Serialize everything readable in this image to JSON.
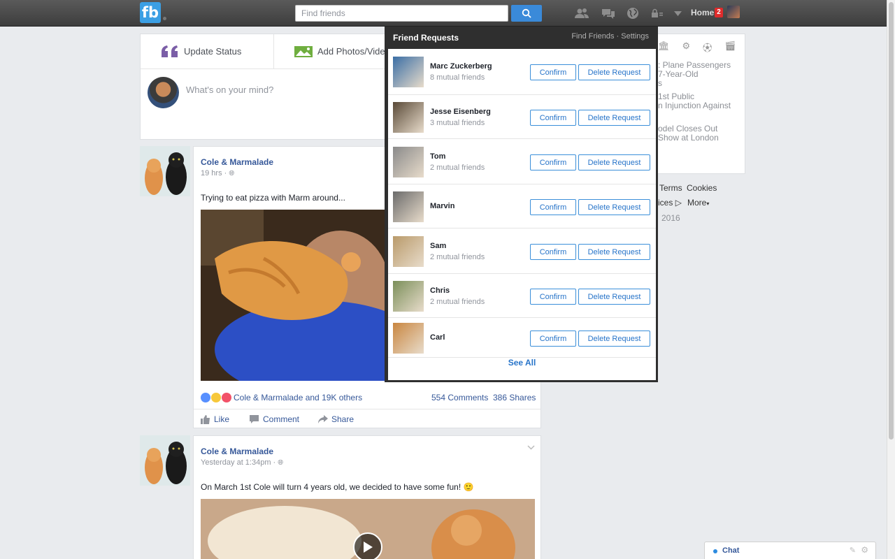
{
  "header": {
    "logo": "fb",
    "search_placeholder": "Find friends",
    "home_label": "Home",
    "home_badge": "2"
  },
  "composer": {
    "tabs": [
      "Update Status",
      "Add Photos/Video"
    ],
    "placeholder": "What's on your mind?"
  },
  "posts": [
    {
      "author": "Cole & Marmalade",
      "time": "19 hrs · ",
      "text": "Trying to eat pizza with Marm around...",
      "reactions_text": "Cole & Marmalade and 19K others",
      "comments": "554 Comments",
      "shares": "386 Shares",
      "actions": [
        "Like",
        "Comment",
        "Share"
      ]
    },
    {
      "author": "Cole & Marmalade",
      "time": "Yesterday at 1:34pm · ",
      "text": "On March 1st Cole will turn 4 years old, we decided to have some fun! 🙂"
    }
  ],
  "trending": [
    ": Plane Passengers",
    "7-Year-Old",
    "s",
    "1st Public",
    "n Injunction Against",
    "odel Closes Out",
    "Show at London"
  ],
  "footer": {
    "terms": "Terms",
    "cookies": "Cookies",
    "ices": "ices",
    "more": "More",
    "year": "2016"
  },
  "friend_requests": {
    "title": "Friend Requests",
    "find_friends": "Find Friends",
    "separator": " · ",
    "settings": "Settings",
    "confirm_label": "Confirm",
    "delete_label": "Delete Request",
    "see_all": "See All",
    "items": [
      {
        "name": "Marc Zuckerberg",
        "mutual": "8 mutual friends",
        "color": "#3a6ea5"
      },
      {
        "name": "Jesse Eisenberg",
        "mutual": "3 mutual friends",
        "color": "#5a4a38"
      },
      {
        "name": "Tom",
        "mutual": "2 mutual friends",
        "color": "#8a8a8a"
      },
      {
        "name": "Marvin",
        "mutual": "",
        "color": "#6b6b6b"
      },
      {
        "name": "Sam",
        "mutual": "2 mutual friends",
        "color": "#b99a6a"
      },
      {
        "name": "Chris",
        "mutual": "2 mutual friends",
        "color": "#7b8f5a"
      },
      {
        "name": "Carl",
        "mutual": "",
        "color": "#c98640"
      }
    ]
  },
  "chat": {
    "label": "Chat"
  }
}
